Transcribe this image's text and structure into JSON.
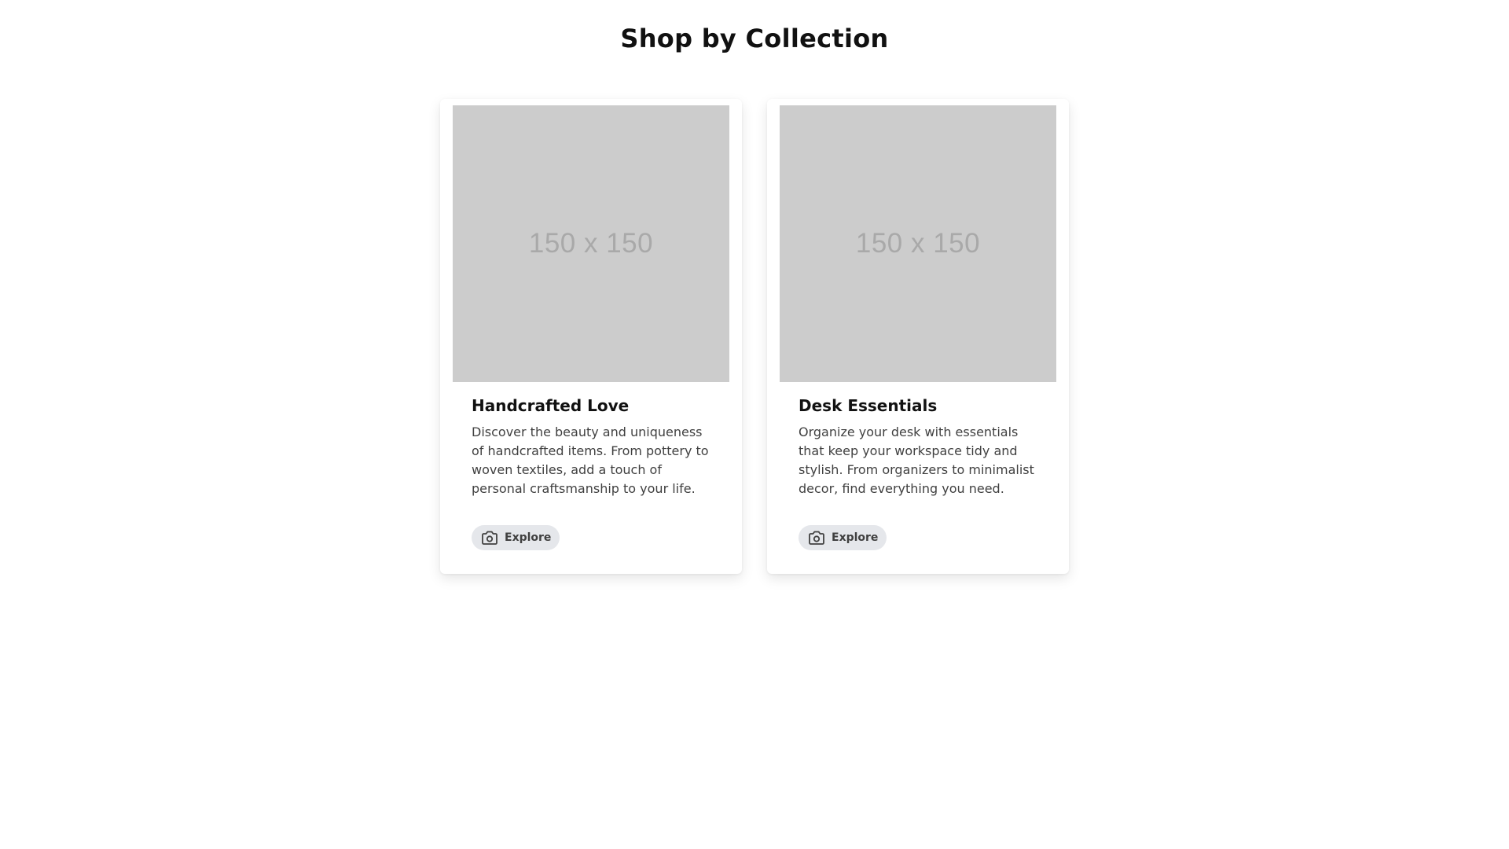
{
  "page": {
    "title": "Shop by Collection"
  },
  "collections": [
    {
      "image_label": "150 x 150",
      "title": "Handcrafted Love",
      "description": "Discover the beauty and uniqueness of handcrafted items. From pottery to woven textiles, add a touch of personal craftsmanship to your life.",
      "button_label": "Explore",
      "button_icon": "camera-icon"
    },
    {
      "image_label": "150 x 150",
      "title": "Desk Essentials",
      "description": "Organize your desk with essentials that keep your workspace tidy and stylish. From organizers to minimalist decor, find everything you need.",
      "button_label": "Explore",
      "button_icon": "camera-icon"
    }
  ],
  "colors": {
    "background": "#ffffff",
    "image_placeholder": "#cccccc",
    "button_background": "#e5e7eb",
    "body_text": "#404040"
  }
}
